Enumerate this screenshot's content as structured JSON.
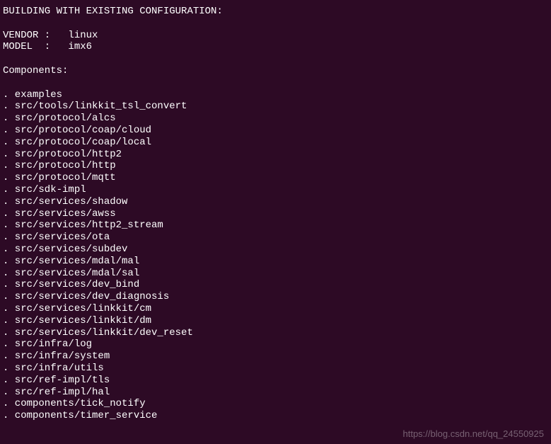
{
  "header": "BUILDING WITH EXISTING CONFIGURATION:",
  "vendor_label": "VENDOR :   ",
  "vendor_value": "linux",
  "model_label": "MODEL  :   ",
  "model_value": "imx6",
  "components_label": "Components:",
  "components": [
    "examples",
    "src/tools/linkkit_tsl_convert",
    "src/protocol/alcs",
    "src/protocol/coap/cloud",
    "src/protocol/coap/local",
    "src/protocol/http2",
    "src/protocol/http",
    "src/protocol/mqtt",
    "src/sdk-impl",
    "src/services/shadow",
    "src/services/awss",
    "src/services/http2_stream",
    "src/services/ota",
    "src/services/subdev",
    "src/services/mdal/mal",
    "src/services/mdal/sal",
    "src/services/dev_bind",
    "src/services/dev_diagnosis",
    "src/services/linkkit/cm",
    "src/services/linkkit/dm",
    "src/services/linkkit/dev_reset",
    "src/infra/log",
    "src/infra/system",
    "src/infra/utils",
    "src/ref-impl/tls",
    "src/ref-impl/hal",
    "components/tick_notify",
    "components/timer_service"
  ],
  "watermark": "https://blog.csdn.net/qq_24550925"
}
